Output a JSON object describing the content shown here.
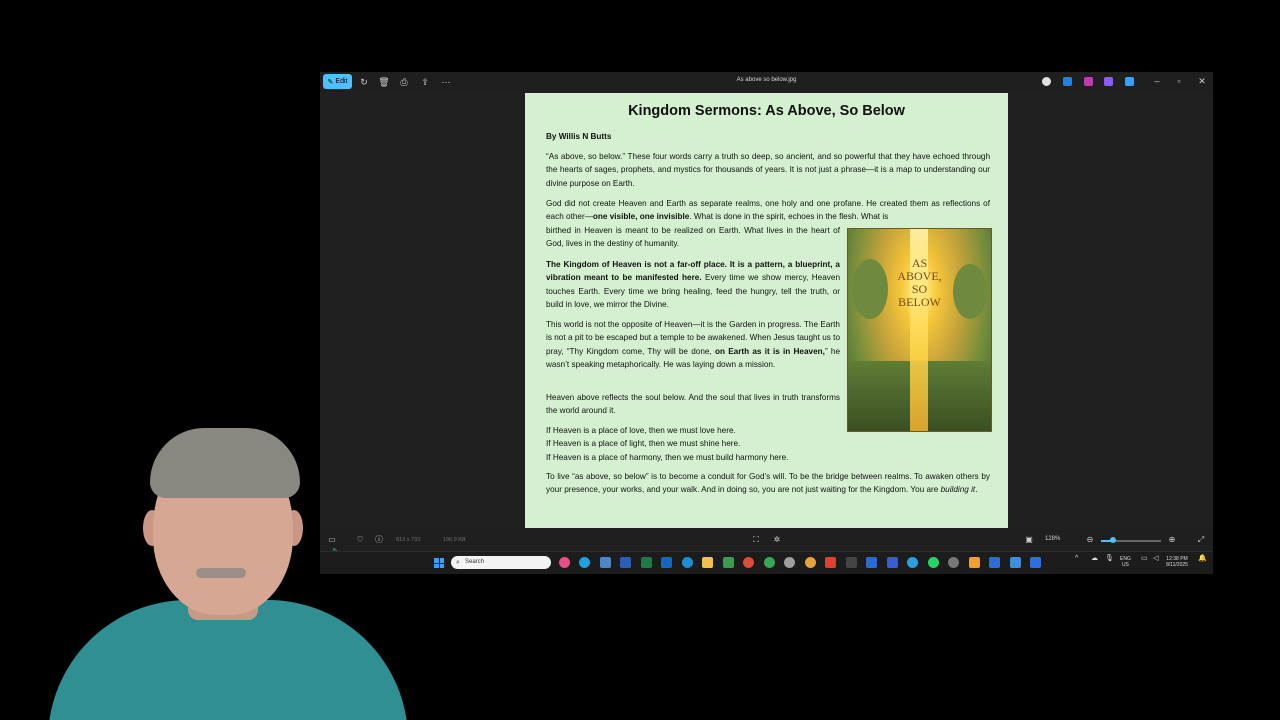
{
  "window": {
    "title": "As above so below.jpg",
    "edit_label": "Edit"
  },
  "document": {
    "title": "Kingdom Sermons: As Above, So Below",
    "byline": "By Willis N Butts",
    "p1": "“As above, so below.” These four words carry a truth so deep, so ancient, and so powerful that they have echoed through the hearts of sages, prophets, and mystics for thousands of years. It is not just a phrase—it is a map to understanding our divine purpose on Earth.",
    "p2_a": "God did not create Heaven and Earth as separate realms, one holy and one profane. He created them as reflections of each other—",
    "p2_bold": "one visible, one invisible",
    "p2_b": ". What is done in the spirit, echoes in the flesh. What is",
    "p2_c": "birthed in Heaven is meant to be realized on Earth. What lives in the heart of God, lives in the destiny of humanity.",
    "p3_bold": "The Kingdom of Heaven is not a far-off place. It is a pattern, a blueprint, a vibration meant to be manifested here.",
    "p3_rest": " Every time we show mercy, Heaven touches Earth. Every time we bring healing, feed the hungry, tell the truth, or build in love, we mirror the Divine.",
    "p4_a": "This world is not the opposite of Heaven—it is the Garden in progress. The Earth is not a pit to be escaped but a temple to be awakened. When Jesus taught us to pray, “Thy Kingdom come, Thy will be done, ",
    "p4_bold": "on Earth as it is in Heaven,",
    "p4_b": "” he wasn’t speaking metaphorically. He was laying down a mission.",
    "p5": "Heaven above reflects the soul below. And the soul that lives in truth transforms the world around it.",
    "p6": [
      "If Heaven is a place of love, then we must love here.",
      "If Heaven is a place of light, then we must shine here.",
      "If Heaven is a place of harmony, then we must build harmony here."
    ],
    "p7_a": "To live “as above, so below” is to become a conduit for God’s will. To be the bridge between realms. To awaken others by your presence, your works, and your walk. And in doing so, you are not just waiting for the Kingdom. You are ",
    "p7_em": "building it",
    "p7_b": ".",
    "image_text": [
      "AS",
      "ABOVE,",
      "SO",
      "BELOW"
    ]
  },
  "statusbar": {
    "dimensions": "813 x 733",
    "filesize": "196.9 KB",
    "zoom": "128%",
    "zoom_level": 0.2
  },
  "taskbar": {
    "search_placeholder": "Search",
    "lang": "ENG",
    "region": "US",
    "time": "12:38 PM",
    "date": "8/11/2025"
  },
  "colors": {
    "accent": "#4cc2ff",
    "doc_background": "#d5f0d1",
    "window_background": "#1f1f1f"
  }
}
